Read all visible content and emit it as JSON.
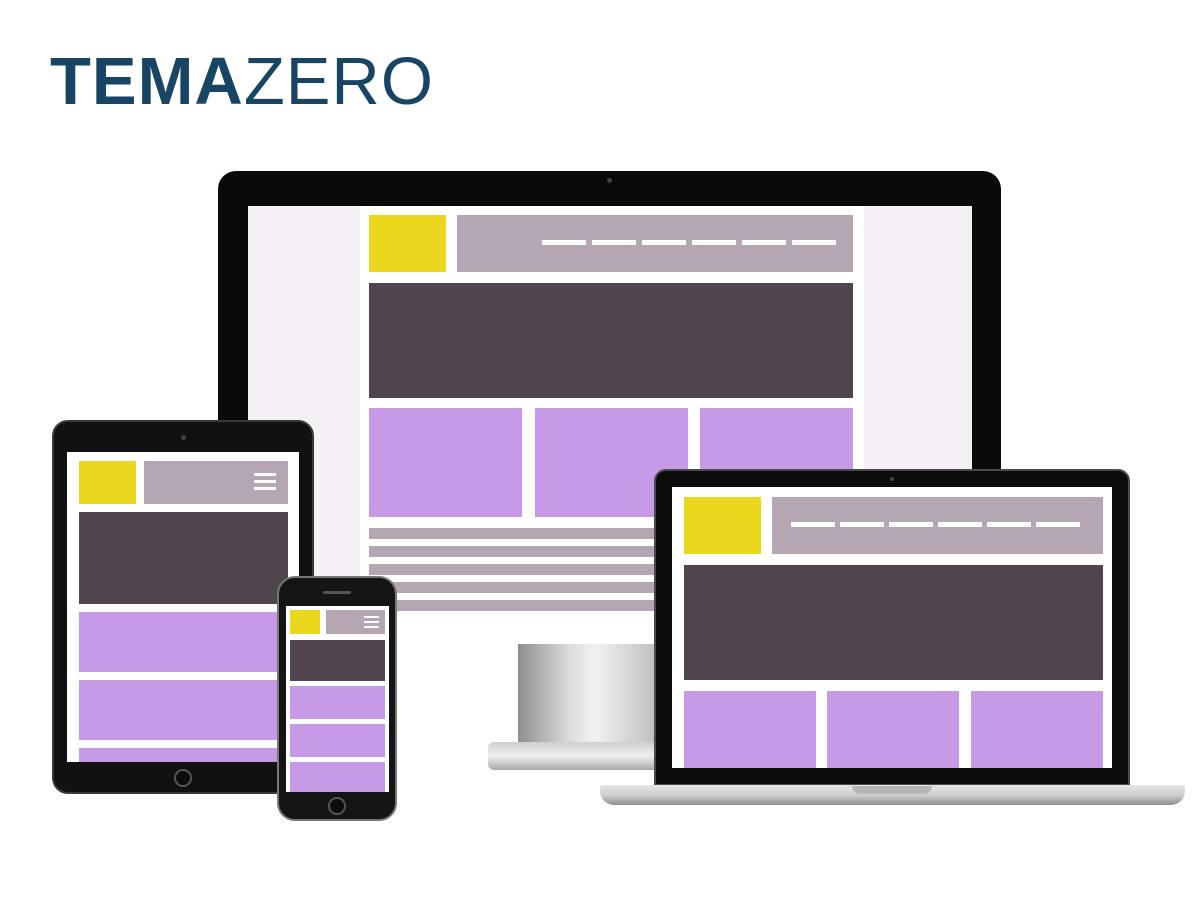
{
  "brand": {
    "logo_bold": "TEMA",
    "logo_light": "ZERO",
    "logo_color": "#184563"
  },
  "palette": {
    "logo_block": "#ebd71d",
    "header_bar": "#b4a6b3",
    "hero_block": "#50444e",
    "content_block": "#c69ae7",
    "desktop_background": "#f5eff6"
  },
  "devices": [
    "desktop-monitor",
    "tablet",
    "smartphone",
    "laptop"
  ]
}
